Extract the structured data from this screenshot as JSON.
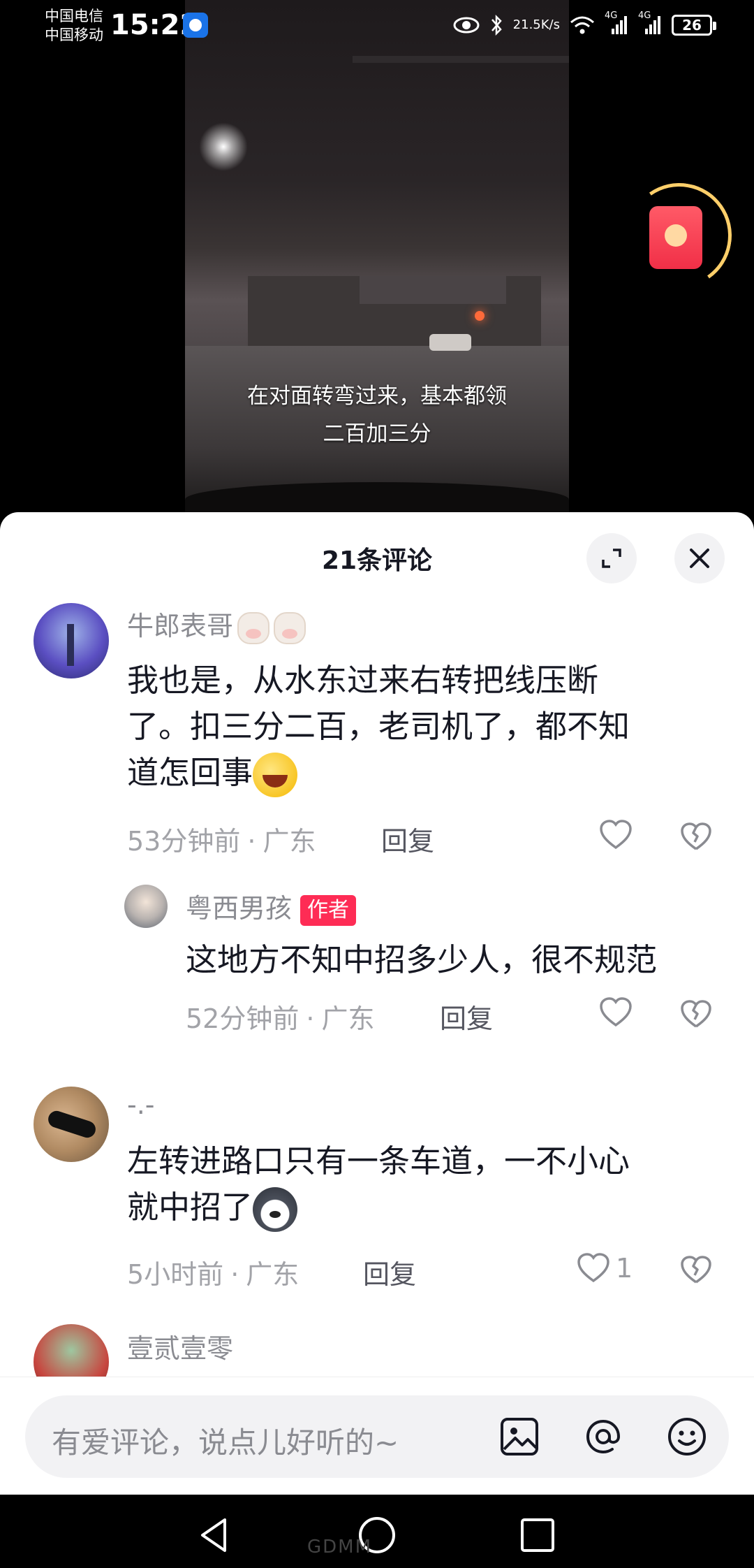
{
  "status_bar": {
    "carrier_1": "中国电信",
    "carrier_2": "中国移动",
    "time": "15:22",
    "net_speed_value": "21.5",
    "net_speed_unit": "K/s",
    "signal_1_label": "4G",
    "signal_2_label": "4G",
    "battery": "26"
  },
  "video": {
    "subtitle_line1": "在对面转弯过来，基本都领",
    "subtitle_line2": "二百加三分"
  },
  "comments_panel": {
    "title": "21条评论",
    "comments": [
      {
        "username": "牛郎表哥",
        "text_line1": "我也是，从水东过来右转把线压断",
        "text_line2": "了。扣三分二百，老司机了，都不知",
        "text_line3": "道怎回事",
        "time": "53分钟前",
        "location": "广东",
        "reply": "回复",
        "likes": ""
      },
      {
        "username": "粤西男孩",
        "badge": "作者",
        "text": "这地方不知中招多少人，很不规范",
        "time": "52分钟前",
        "location": "广东",
        "reply": "回复",
        "likes": ""
      },
      {
        "username": "-.-",
        "text_line1": "左转进路口只有一条车道，一不小心",
        "text_line2": "就中招了",
        "time": "5小时前",
        "location": "广东",
        "reply": "回复",
        "likes": "1"
      },
      {
        "username": "壹贰壹零"
      }
    ],
    "separator": "·"
  },
  "input_bar": {
    "placeholder": "有爱评论，说点儿好听的~"
  },
  "watermark": "GDMM"
}
